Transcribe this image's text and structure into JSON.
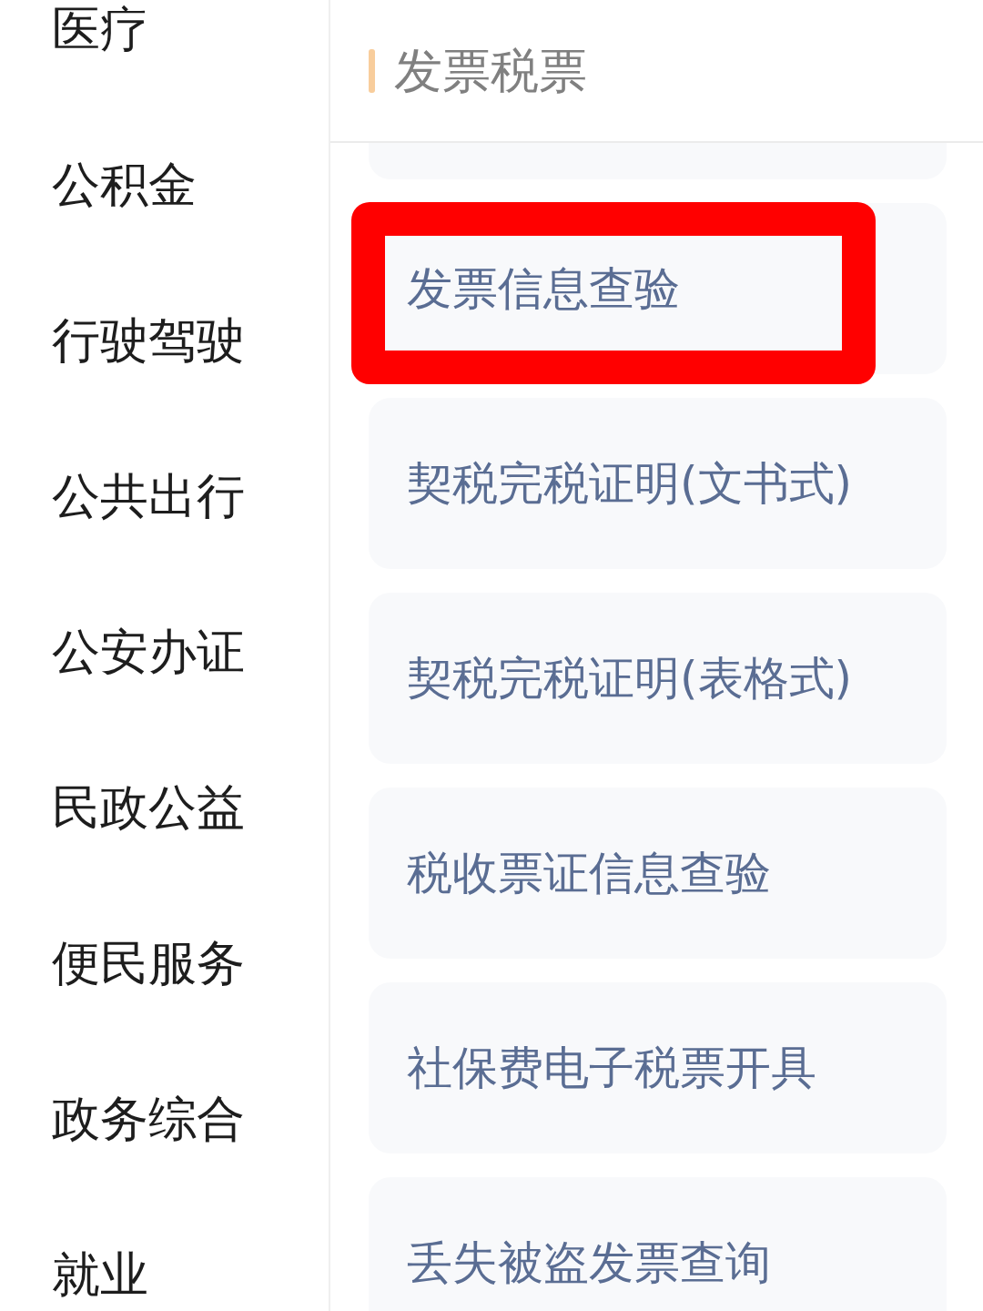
{
  "sidebar": {
    "items": [
      {
        "label": "医疗"
      },
      {
        "label": "公积金"
      },
      {
        "label": "行驶驾驶"
      },
      {
        "label": "公共出行"
      },
      {
        "label": "公安办证"
      },
      {
        "label": "民政公益"
      },
      {
        "label": "便民服务"
      },
      {
        "label": "政务综合"
      },
      {
        "label": "就业"
      }
    ]
  },
  "section": {
    "title": "发票税票",
    "items": [
      {
        "label": "发票信息查验",
        "highlighted": true
      },
      {
        "label": "契税完税证明(文书式)",
        "highlighted": false
      },
      {
        "label": "契税完税证明(表格式)",
        "highlighted": false
      },
      {
        "label": "税收票证信息查验",
        "highlighted": false
      },
      {
        "label": "社保费电子税票开具",
        "highlighted": false
      },
      {
        "label": "丢失被盗发票查询",
        "highlighted": false
      }
    ]
  }
}
